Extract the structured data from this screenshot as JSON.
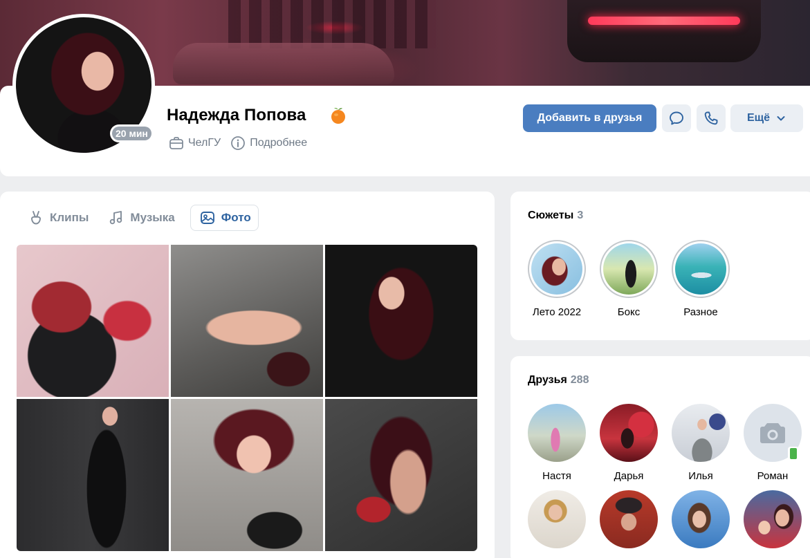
{
  "profile": {
    "name": "Надежда Попова",
    "online_badge": "20 мин",
    "university": "ЧелГУ",
    "details_link": "Подробнее",
    "status_emoji_icon": "tangerine-icon"
  },
  "actions": {
    "add_friend": "Добавить в друзья",
    "more": "Ещё",
    "message_icon": "message-icon",
    "call_icon": "phone-icon"
  },
  "tabs": [
    {
      "label": "Клипы",
      "icon": "clips-icon",
      "active": false
    },
    {
      "label": "Музыка",
      "icon": "music-icon",
      "active": false
    },
    {
      "label": "Фото",
      "icon": "photo-icon",
      "active": true
    }
  ],
  "stories": {
    "title": "Сюжеты",
    "count": "3",
    "items": [
      {
        "label": "Лето 2022"
      },
      {
        "label": "Бокс"
      },
      {
        "label": "Разное"
      }
    ]
  },
  "friends": {
    "title": "Друзья",
    "count": "288",
    "items": [
      {
        "name": "Настя"
      },
      {
        "name": "Дарья"
      },
      {
        "name": "Илья"
      },
      {
        "name": "Роман"
      }
    ]
  },
  "colors": {
    "primary_button": "#4a7dc0",
    "secondary_button": "#ebeff4",
    "link": "#2e63a0",
    "muted_text": "#818c99",
    "page_bg": "#edeef0"
  }
}
